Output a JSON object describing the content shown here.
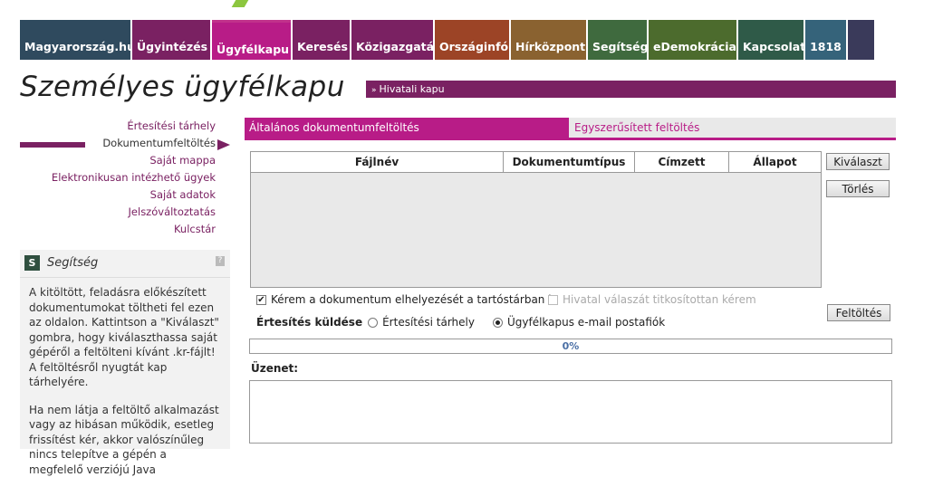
{
  "nav": {
    "items": [
      {
        "label": "Magyarország.hu",
        "color": "#2f4a5e",
        "width": 122
      },
      {
        "label": "Ügyintézés",
        "color": "#7a2162",
        "width": 86
      },
      {
        "label": "Ügyfélkapu",
        "color": "#b81c87",
        "width": 87,
        "active": true
      },
      {
        "label": "Keresés",
        "color": "#7a2162",
        "width": 63
      },
      {
        "label": "Közigazgatás",
        "color": "#7a2162",
        "width": 90
      },
      {
        "label": "Országinfó",
        "color": "#9c4426",
        "width": 82
      },
      {
        "label": "Hírközpont",
        "color": "#8a6230",
        "width": 83
      },
      {
        "label": "Segítség",
        "color": "#3f6a3e",
        "width": 65
      },
      {
        "label": "eDemokrácia",
        "color": "#4c6b2d",
        "width": 97
      },
      {
        "label": "Kapcsolat",
        "color": "#2f5a48",
        "width": 72
      },
      {
        "label": "1818",
        "color": "#35637a",
        "width": 45
      },
      {
        "label": "",
        "color": "#3a3a5a",
        "width": 29
      }
    ]
  },
  "page_title": "Személyes ügyfélkapu",
  "hivatali": {
    "arrow": "»",
    "label": "Hivatali kapu"
  },
  "sidebar": {
    "items": [
      {
        "label": "Értesítési tárhely"
      },
      {
        "label": "Dokumentumfeltöltés",
        "active": true
      },
      {
        "label": "Saját mappa"
      },
      {
        "label": "Elektronikusan intézhető ügyek"
      },
      {
        "label": "Saját adatok"
      },
      {
        "label": "Jelszóváltoztatás"
      },
      {
        "label": "Kulcstár"
      }
    ]
  },
  "help": {
    "badge": "S",
    "title": "Segítség",
    "q": "?",
    "p1": "A kitöltött, feladásra előkészített dokumentumokat töltheti fel ezen az oldalon. Kattintson a \"Kiválaszt\" gombra, hogy kiválaszthassa saját gépéről a feltölteni kívánt .kr-fájlt! A feltöltésről nyugtát kap tárhelyére.",
    "p2": "Ha nem látja a feltöltő alkalmazást vagy az hibásan működik, esetleg frissítést kér, akkor valószínűleg nincs telepítve a gépén a megfelelő verziójú Java"
  },
  "tabs": {
    "active": "Általános dokumentumfeltöltés",
    "inactive": "Egyszerűsített feltöltés"
  },
  "table": {
    "columns": [
      {
        "label": "Fájlnév",
        "width": 279
      },
      {
        "label": "Dokumentumtípus",
        "width": 145
      },
      {
        "label": "Címzett",
        "width": 104
      },
      {
        "label": "Állapot",
        "width": 101
      }
    ]
  },
  "buttons": {
    "select": "Kiválaszt",
    "delete": "Törlés",
    "upload": "Feltöltés"
  },
  "options": {
    "store_label": "Kérem a dokumentum elhelyezését a tartóstárban is",
    "store_checked": true,
    "encrypt_label": "Hivatal válaszát titkosítottan kérem",
    "encrypt_checked": false
  },
  "notify": {
    "label": "Értesítés küldése",
    "option1": "Értesítési tárhely",
    "option2": "Ügyfélkapus e-mail postafiók",
    "selected": 2
  },
  "progress": {
    "text": "0%",
    "value": 0
  },
  "message": {
    "label": "Üzenet:",
    "value": ""
  }
}
